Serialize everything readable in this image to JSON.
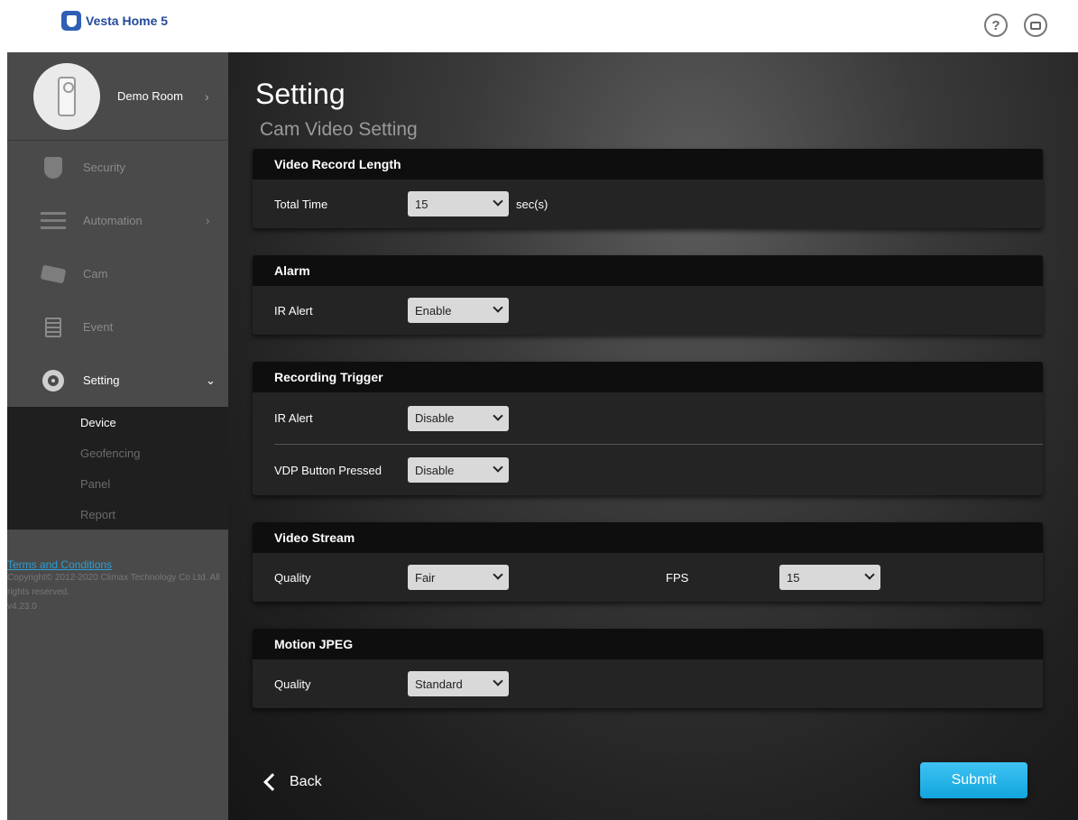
{
  "app": {
    "name": "Vesta Home 5"
  },
  "header": {
    "help_symbol": "?"
  },
  "sidebar": {
    "room": {
      "name": "Demo Room",
      "arrow": "›"
    },
    "items": [
      {
        "label": "Security",
        "icon": "shield-icon"
      },
      {
        "label": "Automation",
        "icon": "sliders-icon",
        "arrow": "›"
      },
      {
        "label": "Cam",
        "icon": "camera-icon"
      },
      {
        "label": "Event",
        "icon": "list-icon"
      },
      {
        "label": "Setting",
        "icon": "gear-icon",
        "arrow": "⌄"
      }
    ],
    "subitems": [
      {
        "label": "Device"
      },
      {
        "label": "Geofencing"
      },
      {
        "label": "Panel"
      },
      {
        "label": "Report"
      }
    ],
    "footer": {
      "terms": "Terms and Conditions",
      "copyright": "Copyright© 2012-2020 Climax Technology Co Ltd. All rights reserved.",
      "version": "v4.23.0"
    }
  },
  "main": {
    "title": "Setting",
    "subtitle": "Cam Video Setting",
    "sections": {
      "video_record": {
        "header": "Video Record Length",
        "total_time_label": "Total Time",
        "total_time_value": "15",
        "unit": "sec(s)"
      },
      "alarm": {
        "header": "Alarm",
        "ir_alert_label": "IR Alert",
        "ir_alert_value": "Enable"
      },
      "recording_trigger": {
        "header": "Recording Trigger",
        "ir_alert_label": "IR Alert",
        "ir_alert_value": "Disable",
        "vdp_label": "VDP Button Pressed",
        "vdp_value": "Disable"
      },
      "video_stream": {
        "header": "Video Stream",
        "quality_label": "Quality",
        "quality_value": "Fair",
        "fps_label": "FPS",
        "fps_value": "15"
      },
      "motion_jpeg": {
        "header": "Motion JPEG",
        "quality_label": "Quality",
        "quality_value": "Standard"
      }
    },
    "back_label": "Back",
    "submit_label": "Submit"
  },
  "colors": {
    "accent": "#2a9fd6",
    "submit": "#1fb3ea",
    "sidebar_bg": "#4a4a4a",
    "panel_header": "#0e0e0e"
  }
}
